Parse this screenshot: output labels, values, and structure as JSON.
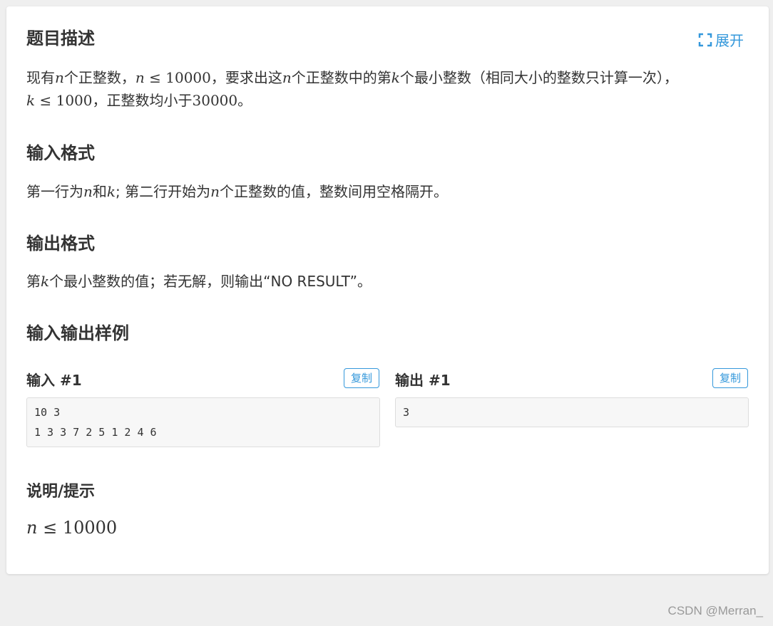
{
  "description": {
    "title": "题目描述",
    "expand_label": "展开",
    "line1": [
      {
        "t": "现有"
      },
      {
        "m": "n"
      },
      {
        "t": "个正整数，"
      },
      {
        "m": "n"
      },
      {
        "r": " ≤ 10000"
      },
      {
        "t": "，要求出这"
      },
      {
        "m": "n"
      },
      {
        "t": "个正整数中的第"
      },
      {
        "m": "k"
      },
      {
        "t": "个最小整数（相同大小的整数只计算一次），"
      }
    ],
    "line2": [
      {
        "m": "k"
      },
      {
        "r": " ≤ 1000"
      },
      {
        "t": "，正整数均小于"
      },
      {
        "r": "30000"
      },
      {
        "t": "。"
      }
    ]
  },
  "input_format": {
    "title": "输入格式",
    "text": [
      {
        "t": "第一行为"
      },
      {
        "m": "n"
      },
      {
        "t": "和"
      },
      {
        "m": "k"
      },
      {
        "t": "; 第二行开始为"
      },
      {
        "m": "n"
      },
      {
        "t": "个正整数的值，整数间用空格隔开。"
      }
    ]
  },
  "output_format": {
    "title": "输出格式",
    "text": [
      {
        "t": "第"
      },
      {
        "m": "k"
      },
      {
        "t": "个最小整数的值；若无解，则输出“NO RESULT”。"
      }
    ]
  },
  "samples": {
    "title": "输入输出样例",
    "input_label": "输入 #1",
    "output_label": "输出 #1",
    "copy_label": "复制",
    "input_text": "10 3\n1 3 3 7 2 5 1 2 4 6",
    "output_text": "3"
  },
  "hint": {
    "title": "说明/提示",
    "text": [
      {
        "m": "n"
      },
      {
        "r": " ≤ 10000"
      }
    ]
  },
  "watermark": "CSDN @Merran_",
  "colors": {
    "accent": "#3498db",
    "background": "#efefef",
    "card": "#ffffff"
  }
}
